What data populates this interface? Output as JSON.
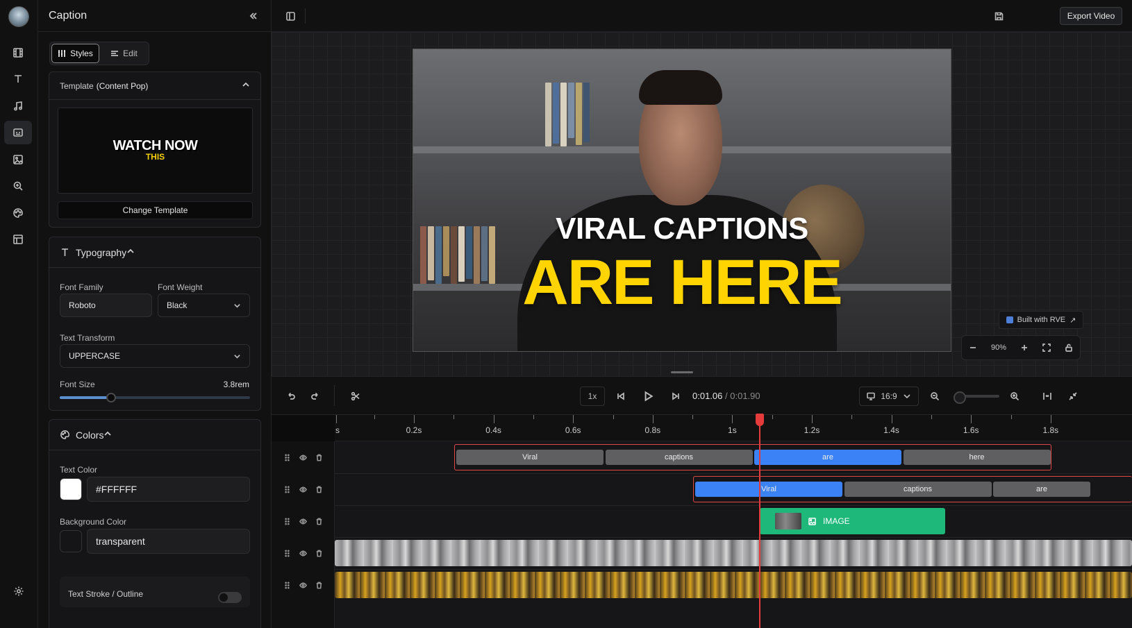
{
  "panel": {
    "title": "Caption",
    "tabs": [
      {
        "label": "Styles"
      },
      {
        "label": "Edit"
      }
    ],
    "template": {
      "label": "Template",
      "name": "(Content Pop)",
      "preview_line1": "WATCH NOW",
      "preview_line2": "THIS",
      "change_button": "Change Template"
    },
    "typography": {
      "title": "Typography",
      "font_family_label": "Font Family",
      "font_family_value": "Roboto",
      "font_weight_label": "Font Weight",
      "font_weight_value": "Black",
      "text_transform_label": "Text Transform",
      "text_transform_value": "UPPERCASE",
      "font_size_label": "Font Size",
      "font_size_value": "3.8rem",
      "font_size_slider_fraction": 0.27
    },
    "colors": {
      "title": "Colors",
      "text_color_label": "Text Color",
      "text_color_value": "#FFFFFF",
      "bg_color_label": "Background Color",
      "bg_color_value": "transparent",
      "stroke_label": "Text Stroke / Outline"
    }
  },
  "topbar": {
    "export_label": "Export Video"
  },
  "canvas": {
    "caption_line1": "VIRAL CAPTIONS",
    "caption_line2": "ARE HERE",
    "badge": "Built with RVE",
    "zoom": "90%"
  },
  "timeline": {
    "speed": "1x",
    "current_time": "0:01.06",
    "total_time": "0:01.90",
    "aspect": "16:9",
    "ruler": [
      "s",
      "0.2s",
      "0.4s",
      "0.6s",
      "0.8s",
      "1s",
      "1.2s",
      "1.4s",
      "1.6s",
      "1.8s"
    ],
    "track1_words": [
      "Viral",
      "captions",
      "are",
      "here"
    ],
    "track2_words": [
      "Viral",
      "captions",
      "are"
    ],
    "image_clip_label": "IMAGE"
  },
  "colors": {
    "accent_blue": "#3b82f6",
    "image_green": "#1db87a",
    "playhead_red": "#e53b3b",
    "caption_yellow": "#ffd400"
  }
}
